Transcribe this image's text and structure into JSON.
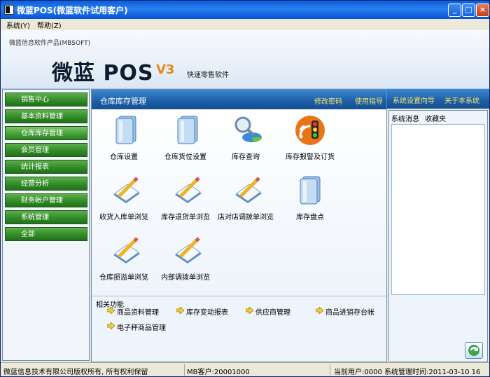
{
  "window": {
    "title": "微蓝POS(微蓝软件试用客户)",
    "min_label": "_",
    "max_label": "□",
    "close_label": "×"
  },
  "menu": [
    {
      "label": "系统(Y)"
    },
    {
      "label": "帮助(Z)"
    }
  ],
  "banner": {
    "company": "微蓝信息软件产品(MBSOFT)",
    "product": "微蓝 POS",
    "version": "V3",
    "slogan": "快速零售软件"
  },
  "sidebar": {
    "items": [
      {
        "label": "销售中心"
      },
      {
        "label": "基本资料管理"
      },
      {
        "label": "仓库库存管理"
      },
      {
        "label": "会员管理"
      },
      {
        "label": "统计报表"
      },
      {
        "label": "经营分析"
      },
      {
        "label": "财务帐户管理"
      },
      {
        "label": "系统管理"
      },
      {
        "label": "全部"
      }
    ],
    "active_index": 2
  },
  "main": {
    "title": "仓库库存管理",
    "links": [
      {
        "label": "修改密码"
      },
      {
        "label": "使用指导"
      },
      {
        "label": "系统设置向导"
      },
      {
        "label": "关于本系统"
      }
    ],
    "tiles": [
      {
        "label": "仓库设置",
        "icon": "book-stack-icon"
      },
      {
        "label": "仓库货位设置",
        "icon": "book-stack-icon"
      },
      {
        "label": "库存查询",
        "icon": "magnifier-pie-icon"
      },
      {
        "label": "库存报警及订货",
        "icon": "traffic-light-icon"
      },
      {
        "label": "收货入库单浏览",
        "icon": "pencil-pad-icon"
      },
      {
        "label": "库存退货单浏览",
        "icon": "pencil-pad-icon"
      },
      {
        "label": "店对店调拨单浏览",
        "icon": "pencil-pad-icon"
      },
      {
        "label": "库存盘点",
        "icon": "book-stack-icon"
      },
      {
        "label": "仓库损溢单浏览",
        "icon": "pencil-pad-icon"
      },
      {
        "label": "内部调拨单浏览",
        "icon": "pencil-pad-icon"
      }
    ],
    "related": {
      "title": "相关功能",
      "items": [
        {
          "label": "商品资料管理"
        },
        {
          "label": "库存变动报表"
        },
        {
          "label": "供应商管理"
        },
        {
          "label": "商品进销存台帐"
        },
        {
          "label": "电子秤商品管理"
        }
      ]
    }
  },
  "rightpanel": {
    "tab_messages": "系统消息",
    "tab_favorites": "收藏夹"
  },
  "status": {
    "copyright": "微蓝信息技术有限公司版权所有, 所有权利保留",
    "customer": "MB客户:20001000",
    "user": "当前用户:0000",
    "time": "系统管理时间:2011-03-10 16"
  },
  "colors": {
    "accent_green": "#2d8a24",
    "header_blue": "#1b5ea8",
    "link_yellow": "#f5e36a"
  }
}
